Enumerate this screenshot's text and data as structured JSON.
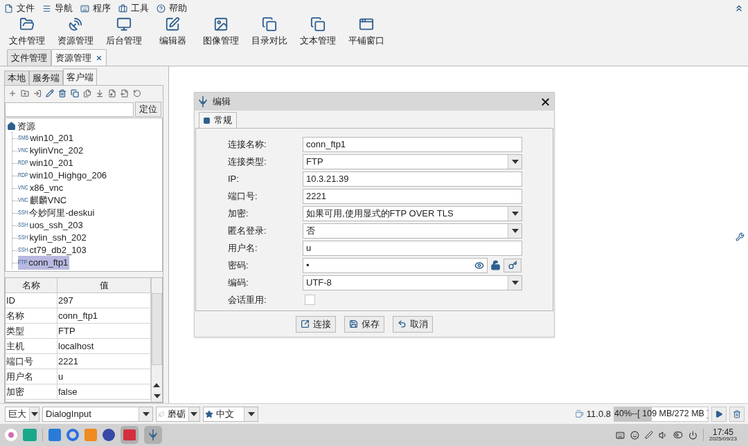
{
  "menu": [
    {
      "label": "文件"
    },
    {
      "label": "导航"
    },
    {
      "label": "程序"
    },
    {
      "label": "工具"
    },
    {
      "label": "帮助"
    }
  ],
  "toolbar": [
    {
      "label": "文件管理"
    },
    {
      "label": "资源管理"
    },
    {
      "label": "后台管理"
    },
    {
      "label": "编辑器"
    },
    {
      "label": "图像管理"
    },
    {
      "label": "目录对比"
    },
    {
      "label": "文本管理"
    },
    {
      "label": "平铺窗口"
    }
  ],
  "doc_tabs": [
    {
      "label": "文件管理",
      "selected": false,
      "closable": false
    },
    {
      "label": "资源管理",
      "selected": true,
      "closable": true
    }
  ],
  "side_tabs": [
    {
      "label": "本地",
      "selected": false
    },
    {
      "label": "服务端",
      "selected": false
    },
    {
      "label": "客户端",
      "selected": true
    }
  ],
  "locate_button": "定位",
  "tree": {
    "label": "资源",
    "children": [
      {
        "type": "SMB",
        "label": "win10_201",
        "selected": false
      },
      {
        "type": "VNC",
        "label": "kylinVnc_202",
        "selected": false
      },
      {
        "type": "RDP",
        "label": "win10_201",
        "selected": false
      },
      {
        "type": "RDP",
        "label": "win10_Highgo_206",
        "selected": false
      },
      {
        "type": "VNC",
        "label": "x86_vnc",
        "selected": false
      },
      {
        "type": "VNC",
        "label": "麒麟VNC",
        "selected": false
      },
      {
        "type": "SSH",
        "label": "今妙阿里-deskui",
        "selected": false
      },
      {
        "type": "SSH",
        "label": "uos_ssh_203",
        "selected": false
      },
      {
        "type": "SSH",
        "label": "kylin_ssh_202",
        "selected": false
      },
      {
        "type": "SSH",
        "label": "ct79_db2_103",
        "selected": false
      },
      {
        "type": "FTP",
        "label": "conn_ftp1",
        "selected": true
      }
    ]
  },
  "properties": {
    "columns": [
      "名称",
      "值"
    ],
    "rows": [
      [
        "ID",
        "297"
      ],
      [
        "名称",
        "conn_ftp1"
      ],
      [
        "类型",
        "FTP"
      ],
      [
        "主机",
        "localhost"
      ],
      [
        "端口号",
        "2221"
      ],
      [
        "用户名",
        "u"
      ],
      [
        "加密",
        "false"
      ]
    ]
  },
  "dialog": {
    "title": "编辑",
    "tab": "常规",
    "fields": [
      {
        "kind": "text",
        "label": "连接名称:",
        "value": "conn_ftp1"
      },
      {
        "kind": "select",
        "label": "连接类型:",
        "value": "FTP"
      },
      {
        "kind": "text",
        "label": "IP:",
        "value": "10.3.21.39"
      },
      {
        "kind": "text",
        "label": "端口号:",
        "value": "2221"
      },
      {
        "kind": "select",
        "label": "加密:",
        "value": "如果可用,使用显式的FTP OVER TLS"
      },
      {
        "kind": "select",
        "label": "匿名登录:",
        "value": "否"
      },
      {
        "kind": "text",
        "label": "用户名:",
        "value": "u"
      },
      {
        "kind": "password",
        "label": "密码:",
        "value": "•"
      },
      {
        "kind": "select",
        "label": "编码:",
        "value": "UTF-8"
      },
      {
        "kind": "checkbox",
        "label": "会话重用:",
        "checked": false
      }
    ],
    "buttons": [
      "连接",
      "保存",
      "取消"
    ]
  },
  "status": {
    "size": "巨大",
    "font": "DialogInput",
    "theme": "磨砺",
    "language": "中文",
    "version": "11.0.8",
    "memory": {
      "text": "40%--[ 109 MB/272 MB ]",
      "level": 0.4
    }
  },
  "taskbar": {
    "time": "17:45",
    "date": "2025/09/23"
  }
}
